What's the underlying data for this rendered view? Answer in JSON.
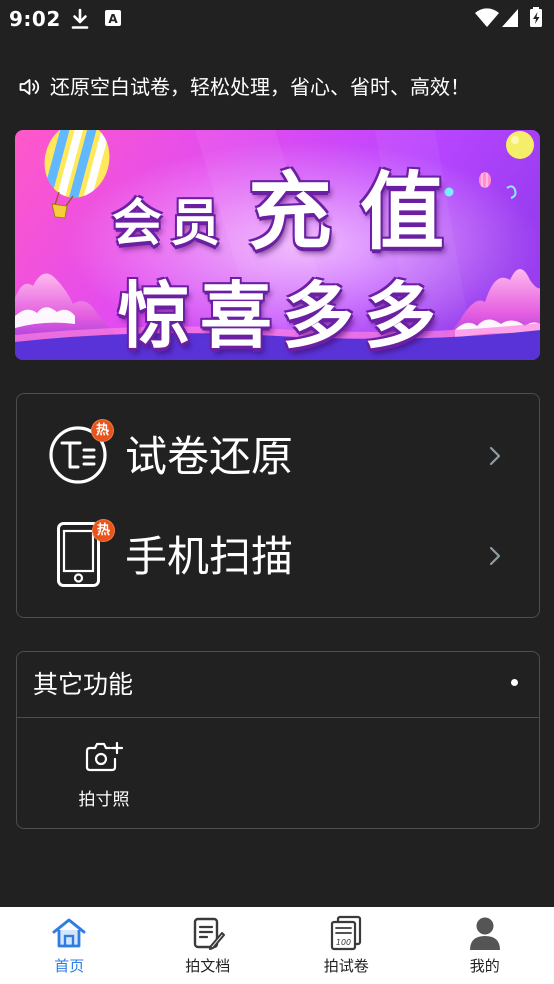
{
  "status_bar": {
    "time": "9:02",
    "notification_icon_text": "A",
    "icons": [
      "download-icon",
      "app-notification-icon",
      "wifi-icon",
      "signal-icon",
      "battery-charging-icon"
    ]
  },
  "notice": {
    "icon": "speaker-icon",
    "text": "还原空白试卷，轻松处理，省心、省时、高效！"
  },
  "banner": {
    "title_small": "会员",
    "title_large": "充值",
    "subtitle": "惊喜多多"
  },
  "main_features": [
    {
      "label": "试卷还原",
      "badge": "热",
      "icon": "exam-restore-icon"
    },
    {
      "label": "手机扫描",
      "badge": "热",
      "icon": "phone-scan-icon"
    }
  ],
  "other_functions": {
    "title": "其它功能",
    "items": [
      {
        "label": "拍寸照",
        "icon": "camera-plus-icon"
      }
    ]
  },
  "bottom_nav": [
    {
      "label": "首页",
      "icon": "home-icon",
      "active": true
    },
    {
      "label": "拍文档",
      "icon": "document-icon",
      "active": false
    },
    {
      "label": "拍试卷",
      "icon": "exam-paper-icon",
      "icon_text": "100",
      "active": false
    },
    {
      "label": "我的",
      "icon": "user-icon",
      "active": false
    }
  ],
  "colors": {
    "background": "#212121",
    "card_border": "#4d4d4d",
    "hot_badge": "#e8541b",
    "accent": "#2f7de1",
    "nav_background": "#ffffff"
  }
}
